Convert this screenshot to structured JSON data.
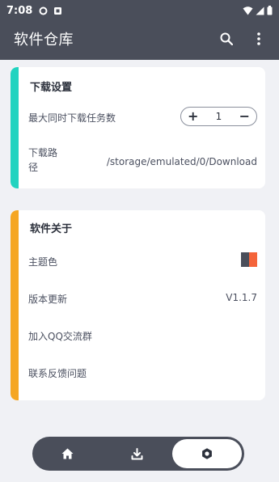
{
  "status_bar": {
    "time": "7:08"
  },
  "app_bar": {
    "title": "软件仓库"
  },
  "download_settings": {
    "title": "下载设置",
    "max_tasks_label": "最大同时下载任务数",
    "max_tasks_value": "1",
    "minus": "−",
    "plus": "+",
    "path_label": "下载路径",
    "path_value": "/storage/emulated/0/Download"
  },
  "about": {
    "title": "软件关于",
    "theme_label": "主题色",
    "version_label": "版本更新",
    "version_value": "V1.1.7",
    "qq_group_label": "加入QQ交流群",
    "feedback_label": "联系反馈问题"
  },
  "colors": {
    "theme_dark": "#4a4e5a",
    "theme_accent": "#f4643a",
    "card1_accent": "#22d3c0",
    "card2_accent": "#f5a623"
  },
  "bottom_nav": {
    "items": [
      "home-icon",
      "download-icon",
      "settings-icon"
    ],
    "active": "settings-icon"
  }
}
